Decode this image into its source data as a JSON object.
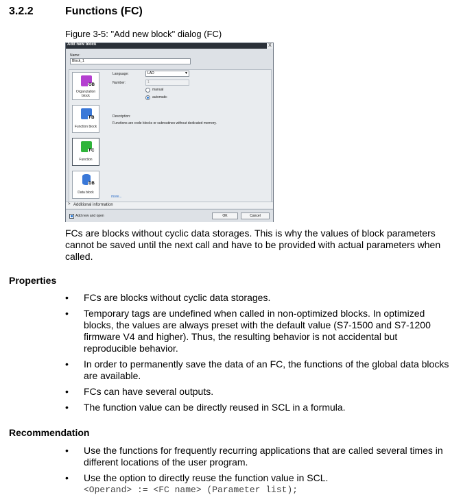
{
  "section": {
    "number": "3.2.2",
    "title": "Functions (FC)"
  },
  "figure_caption": "Figure 3-5: \"Add new block\" dialog (FC)",
  "dialog": {
    "title": "Add new block",
    "close_glyph": "X",
    "name_label": "Name:",
    "name_value": "Block_1",
    "blocks": [
      {
        "code": "OB",
        "label": "Organization block",
        "color": "#b43fd0"
      },
      {
        "code": "FB",
        "label": "Function block",
        "color": "#3a78d8"
      },
      {
        "code": "FC",
        "label": "Function",
        "color": "#2fb43a"
      },
      {
        "code": "DB",
        "label": "Data block",
        "color": "#3a78d8"
      }
    ],
    "language_label": "Language:",
    "language_value": "LAD",
    "number_label": "Number:",
    "number_value": "1",
    "radio_manual": "manual",
    "radio_automatic": "automatic",
    "description_label": "Description:",
    "description_text": "Functions are code blocks or subroutines without dedicated memory.",
    "more_link": "more...",
    "additional_info": "Additional information",
    "add_new_and_open": "Add new and open",
    "ok_button": "OK",
    "cancel_button": "Cancel"
  },
  "intro_paragraph": "FCs are blocks without cyclic data storages. This is why the values of block parameters cannot be saved until the next call and have to be provided with actual parameters when called.",
  "properties": {
    "heading": "Properties",
    "bullet_glyph": "•",
    "items": [
      "FCs are blocks without cyclic data storages.",
      "Temporary tags are undefined when called in non-optimized blocks. In optimized blocks, the values are always preset with the default value (S7-1500 and S7-1200 firmware V4 and higher). Thus, the resulting behavior is not accidental but reproducible behavior.",
      "In order to permanently save the data of an FC, the functions of the global data blocks are available.",
      "FCs can have several outputs.",
      "The function value can be directly reused in SCL in a formula."
    ]
  },
  "recommendation": {
    "heading": "Recommendation",
    "items": [
      "Use the functions for frequently recurring applications that are called several times in different locations of the user program.",
      "Use the option to directly reuse the function value in SCL."
    ],
    "code": "<Operand> := <FC name> (Parameter list);"
  }
}
